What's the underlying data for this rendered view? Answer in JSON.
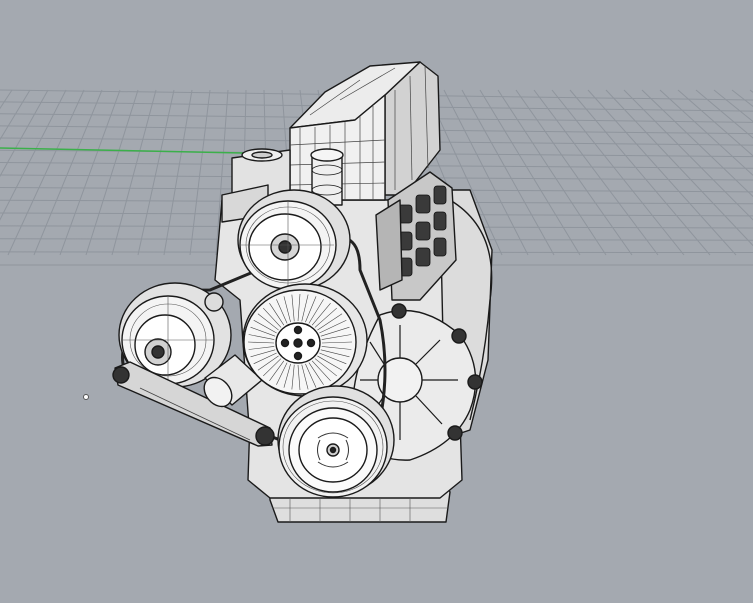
{
  "viewport": {
    "background_color": "#a4a9b0",
    "grid_color": "#8f959d",
    "x_axis_color": "#3bb04a",
    "model_fill": "#e8e8e8",
    "model_edge": "#1a1a1a",
    "display_mode": "ghosted-wireframe"
  },
  "icons": {
    "cursor": "point-marker-icon"
  }
}
